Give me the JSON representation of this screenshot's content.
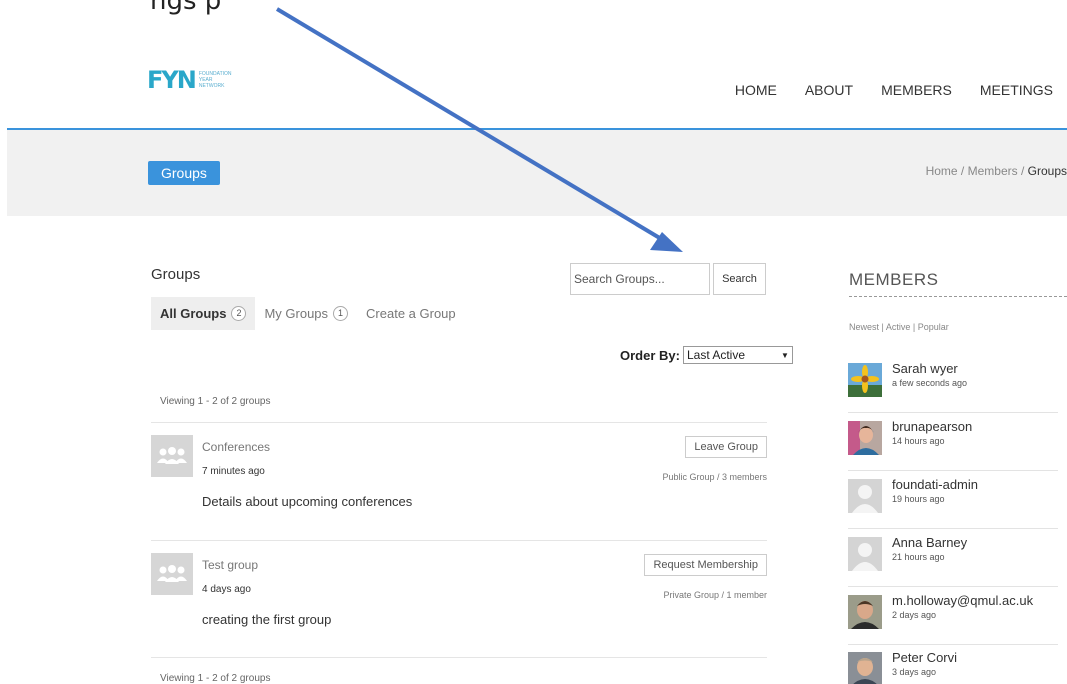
{
  "top_fragment": "ngs p",
  "header": {
    "logo_mark": "FYN",
    "logo_text": [
      "FOUNDATION",
      "YEAR",
      "NETWORK"
    ],
    "nav": [
      "HOME",
      "ABOUT",
      "MEMBERS",
      "MEETINGS"
    ]
  },
  "banner": {
    "title": "Groups",
    "breadcrumb": {
      "home": "Home",
      "sep1": " / ",
      "members": "Members",
      "sep2": " / ",
      "current": "Groups"
    }
  },
  "main": {
    "heading": "Groups",
    "search_placeholder": "Search Groups...",
    "search_button": "Search",
    "tabs": [
      {
        "label": "All Groups",
        "count": "2"
      },
      {
        "label": "My Groups",
        "count": "1"
      },
      {
        "label": "Create a Group"
      }
    ],
    "order_by_label": "Order By:",
    "order_by_value": "Last Active",
    "viewing_text": "Viewing 1 - 2 of 2 groups",
    "groups": [
      {
        "name": "Conferences",
        "time": "7 minutes ago",
        "description": "Details about upcoming conferences",
        "button": "Leave Group",
        "meta": "Public Group / 3 members"
      },
      {
        "name": "Test group",
        "time": "4 days ago",
        "description": "creating the first group",
        "button": "Request Membership",
        "meta": "Private Group / 1 member"
      }
    ]
  },
  "sidebar": {
    "title": "MEMBERS",
    "filter": "Newest | Active | Popular",
    "members": [
      {
        "name": "Sarah wyer",
        "time": "a few seconds ago",
        "avatar": "flower-photo"
      },
      {
        "name": "brunapearson",
        "time": "14 hours ago",
        "avatar": "person-photo"
      },
      {
        "name": "foundati-admin",
        "time": "19 hours ago",
        "avatar": "default-avatar"
      },
      {
        "name": "Anna Barney",
        "time": "21 hours ago",
        "avatar": "default-avatar"
      },
      {
        "name": "m.holloway@qmul.ac.uk",
        "time": "2 days ago",
        "avatar": "person-photo"
      },
      {
        "name": "Peter Corvi",
        "time": "3 days ago",
        "avatar": "person-photo"
      }
    ]
  },
  "colors": {
    "accent": "#3a93dc",
    "annotation_arrow": "#4472c4"
  }
}
